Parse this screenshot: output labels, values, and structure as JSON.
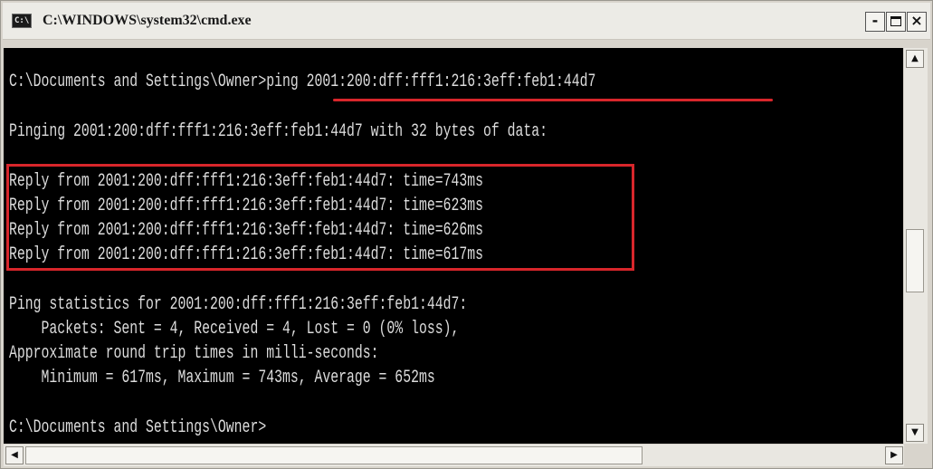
{
  "window": {
    "title": "C:\\WINDOWS\\system32\\cmd.exe",
    "icon_text": "C:\\",
    "controls": {
      "minimize": "-",
      "close": "×"
    }
  },
  "console": {
    "lines": [
      "C:\\Documents and Settings\\Owner>ping 2001:200:dff:fff1:216:3eff:feb1:44d7",
      "Pinging 2001:200:dff:fff1:216:3eff:feb1:44d7 with 32 bytes of data:",
      "Reply from 2001:200:dff:fff1:216:3eff:feb1:44d7: time=743ms",
      "Reply from 2001:200:dff:fff1:216:3eff:feb1:44d7: time=623ms",
      "Reply from 2001:200:dff:fff1:216:3eff:feb1:44d7: time=626ms",
      "Reply from 2001:200:dff:fff1:216:3eff:feb1:44d7: time=617ms",
      "Ping statistics for 2001:200:dff:fff1:216:3eff:feb1:44d7:",
      "    Packets: Sent = 4, Received = 4, Lost = 0 (0% loss),",
      "Approximate round trip times in milli-seconds:",
      "    Minimum = 617ms, Maximum = 743ms, Average = 652ms",
      "C:\\Documents and Settings\\Owner>"
    ],
    "highlight_color": "#d8262b"
  },
  "scrollbars": {
    "up": "▲",
    "down": "▼",
    "left": "◀",
    "right": "▶"
  },
  "colors": {
    "console_bg": "#000000",
    "console_text": "#dcdcdc",
    "window_chrome": "#d8d4cc"
  }
}
